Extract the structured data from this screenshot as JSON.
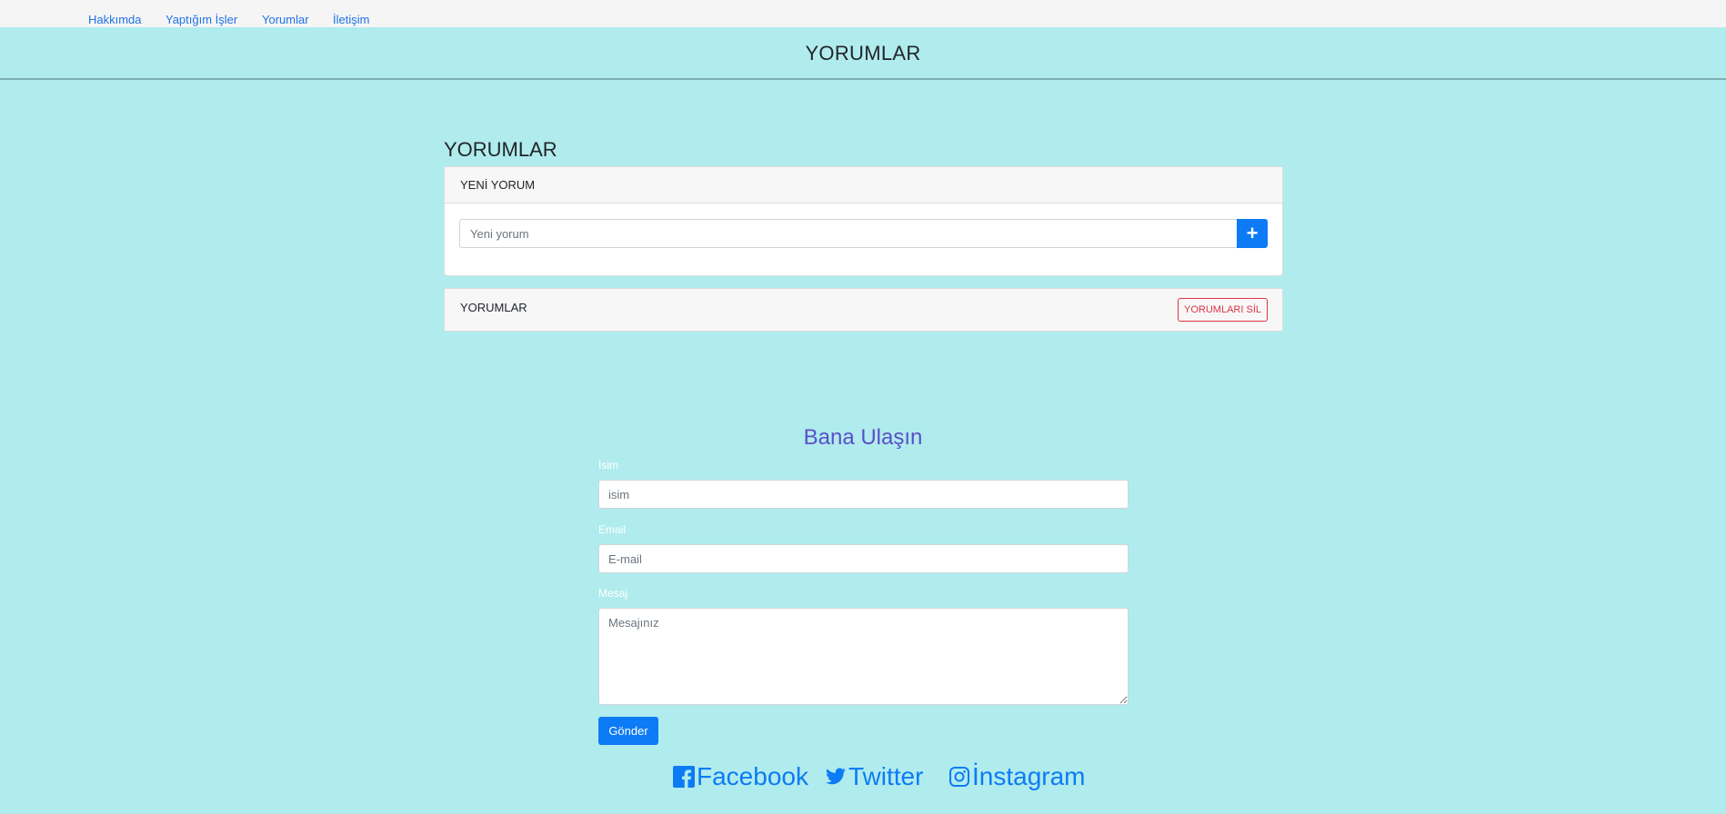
{
  "nav": {
    "items": [
      "Hakkımda",
      "Yaptığım İşler",
      "Yorumlar",
      "İletişim"
    ]
  },
  "header": {
    "title": "YORUMLAR"
  },
  "comments": {
    "section_title": "YORUMLAR",
    "new_card_title": "YENİ YORUM",
    "new_input_placeholder": "Yeni yorum",
    "add_button": "+",
    "list_card_title": "YORUMLAR",
    "delete_button": "YORUMLARI SİL"
  },
  "contact": {
    "title": "Bana Ulaşın",
    "name_label": "İsim",
    "name_placeholder": "isim",
    "email_label": "Email",
    "email_placeholder": "E-mail",
    "message_label": "Mesaj",
    "message_placeholder": "Mesajınız",
    "submit": "Gönder"
  },
  "social": {
    "facebook": "Facebook",
    "twitter": "Twitter",
    "instagram": "İnstagram"
  },
  "colors": {
    "background": "#b0eced",
    "primary": "#0d7bf5",
    "danger": "#dc3545",
    "contact_title": "#5a4fc8"
  }
}
